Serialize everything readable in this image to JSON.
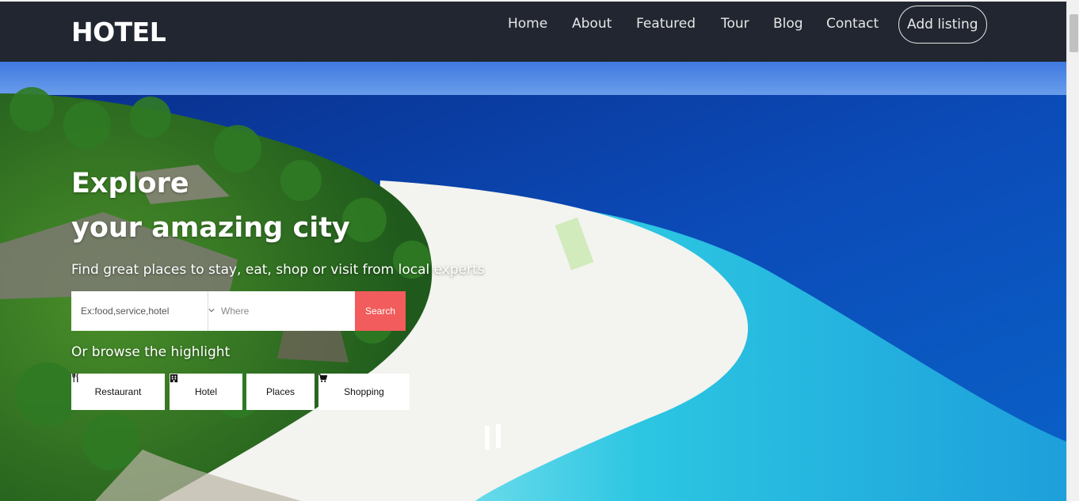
{
  "brand": "HOTEL",
  "nav": {
    "items": [
      "Home",
      "About",
      "Featured",
      "Tour",
      "Blog",
      "Contact"
    ],
    "cta": "Add listing"
  },
  "hero": {
    "title_line1": "Explore",
    "title_line2": "your amazing city",
    "subtitle": "Find great places to stay, eat, shop or visit from local experts",
    "search": {
      "what_placeholder": "Ex:food,service,hotel",
      "where_value": "Where",
      "button": "Search"
    },
    "browse_label": "Or browse the highlight",
    "categories": [
      {
        "label": "Restaurant",
        "icon": "utensils-icon"
      },
      {
        "label": "Hotel",
        "icon": "building-icon"
      },
      {
        "label": "Places",
        "icon": ""
      },
      {
        "label": "Shopping",
        "icon": "cart-icon"
      }
    ]
  },
  "colors": {
    "navbar": "#212630",
    "accent": "#f25c5c",
    "sea_deep": "#0a3a9a",
    "sea_shallow": "#2ec4e0",
    "sand": "#f2f2ee"
  }
}
